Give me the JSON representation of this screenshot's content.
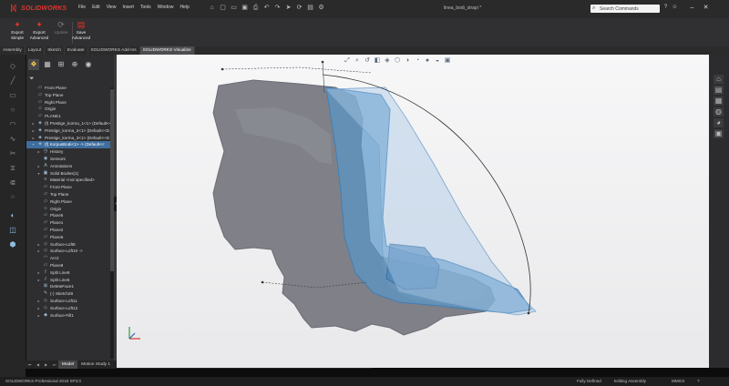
{
  "app": {
    "logo_text": "SOLIDWORKS",
    "document_title": "linea_bodi_strapi *",
    "menus": [
      "File",
      "Edit",
      "View",
      "Insert",
      "Tools",
      "Window",
      "Help"
    ],
    "search_placeholder": "Search Commands"
  },
  "ribbon": {
    "buttons": [
      {
        "label": "Export Simple",
        "icon": "export-simple-icon"
      },
      {
        "label": "Export Advanced",
        "icon": "export-advanced-icon"
      },
      {
        "label": "Update",
        "icon": "update-icon",
        "disabled": true
      },
      {
        "label": "Save Advanced",
        "icon": "save-advanced-icon"
      }
    ]
  },
  "tabs": [
    "Assembly",
    "Layout",
    "Sketch",
    "Evaluate",
    "SOLIDWORKS Add-Ins",
    "SOLIDWORKS Visualize"
  ],
  "active_tab": "SOLIDWORKS Visualize",
  "feature_tree": [
    {
      "label": "Front Plane",
      "indent": 0,
      "icon": "plane-icon"
    },
    {
      "label": "Top Plane",
      "indent": 0,
      "icon": "plane-icon"
    },
    {
      "label": "Right Plane",
      "indent": 0,
      "icon": "plane-icon"
    },
    {
      "label": "Origin",
      "indent": 0,
      "icon": "origin-icon"
    },
    {
      "label": "PLANE1",
      "indent": 0,
      "icon": "plane-icon"
    },
    {
      "label": "(f) Prestige_korma_1<1> (Default<<D",
      "indent": 0,
      "icon": "part-icon",
      "toggle": "▸"
    },
    {
      "label": "Prestige_korma_2<1> (Default<<D",
      "indent": 0,
      "icon": "part-icon",
      "toggle": "▸"
    },
    {
      "label": "Prestige_korma_3<1> (Default<<D",
      "indent": 0,
      "icon": "part-icon",
      "toggle": "▸"
    },
    {
      "label": "(f) KorpusBodi<1> -> (Default<<",
      "indent": 0,
      "icon": "part-icon",
      "toggle": "▾",
      "selected": true
    },
    {
      "label": "History",
      "indent": 1,
      "icon": "history-icon",
      "toggle": "▸"
    },
    {
      "label": "Sensors",
      "indent": 1,
      "icon": "sensor-icon"
    },
    {
      "label": "Annotations",
      "indent": 1,
      "icon": "annotation-icon",
      "toggle": "▸"
    },
    {
      "label": "Solid Bodies(1)",
      "indent": 1,
      "icon": "solid-bodies-icon",
      "toggle": "▾"
    },
    {
      "label": "Material <not specified>",
      "indent": 1,
      "icon": "material-icon"
    },
    {
      "label": "Front Plane",
      "indent": 1,
      "icon": "plane-icon"
    },
    {
      "label": "Top Plane",
      "indent": 1,
      "icon": "plane-icon"
    },
    {
      "label": "Right Plane",
      "indent": 1,
      "icon": "plane-icon"
    },
    {
      "label": "Origin",
      "indent": 1,
      "icon": "origin-icon"
    },
    {
      "label": "Plane5",
      "indent": 1,
      "icon": "plane-icon"
    },
    {
      "label": "Plane1",
      "indent": 1,
      "icon": "plane-icon"
    },
    {
      "label": "Plane2",
      "indent": 1,
      "icon": "plane-icon"
    },
    {
      "label": "Plane6",
      "indent": 1,
      "icon": "plane-icon"
    },
    {
      "label": "Surface-Loft9",
      "indent": 1,
      "icon": "surface-icon",
      "toggle": "▸"
    },
    {
      "label": "Surface-Loft10 -> ",
      "indent": 1,
      "icon": "surface-icon",
      "toggle": "▸"
    },
    {
      "label": "Arc3",
      "indent": 1,
      "icon": "arc-icon"
    },
    {
      "label": "Plane8",
      "indent": 1,
      "icon": "plane-icon"
    },
    {
      "label": "Split Line8",
      "indent": 1,
      "icon": "split-line-icon",
      "toggle": "▸"
    },
    {
      "label": "Split Line5",
      "indent": 1,
      "icon": "split-line-icon",
      "toggle": "▸"
    },
    {
      "label": "DeleteFace1",
      "indent": 1,
      "icon": "delete-face-icon"
    },
    {
      "label": "(-) Sketch28",
      "indent": 1,
      "icon": "sketch-icon"
    },
    {
      "label": "Surface-Loft11",
      "indent": 1,
      "icon": "surface-icon",
      "toggle": "▸"
    },
    {
      "label": "Surface-Loft12",
      "indent": 1,
      "icon": "surface-icon",
      "toggle": "▸"
    },
    {
      "label": "Surface-Fill1",
      "indent": 1,
      "icon": "surface-fill-icon",
      "toggle": "▸"
    }
  ],
  "bottom_tabs": [
    "Model",
    "Motion Study 1"
  ],
  "status": {
    "product": "SOLIDWORKS Professional 2018 SP3.0",
    "definition": "Fully Defined",
    "mode": "Editing Assembly",
    "units": "MMGS"
  },
  "colors": {
    "surface_blue": "#5a97c9",
    "scan_gray": "#7f8088",
    "selection": "#3e6d9e",
    "logo_red": "#e4332b"
  }
}
